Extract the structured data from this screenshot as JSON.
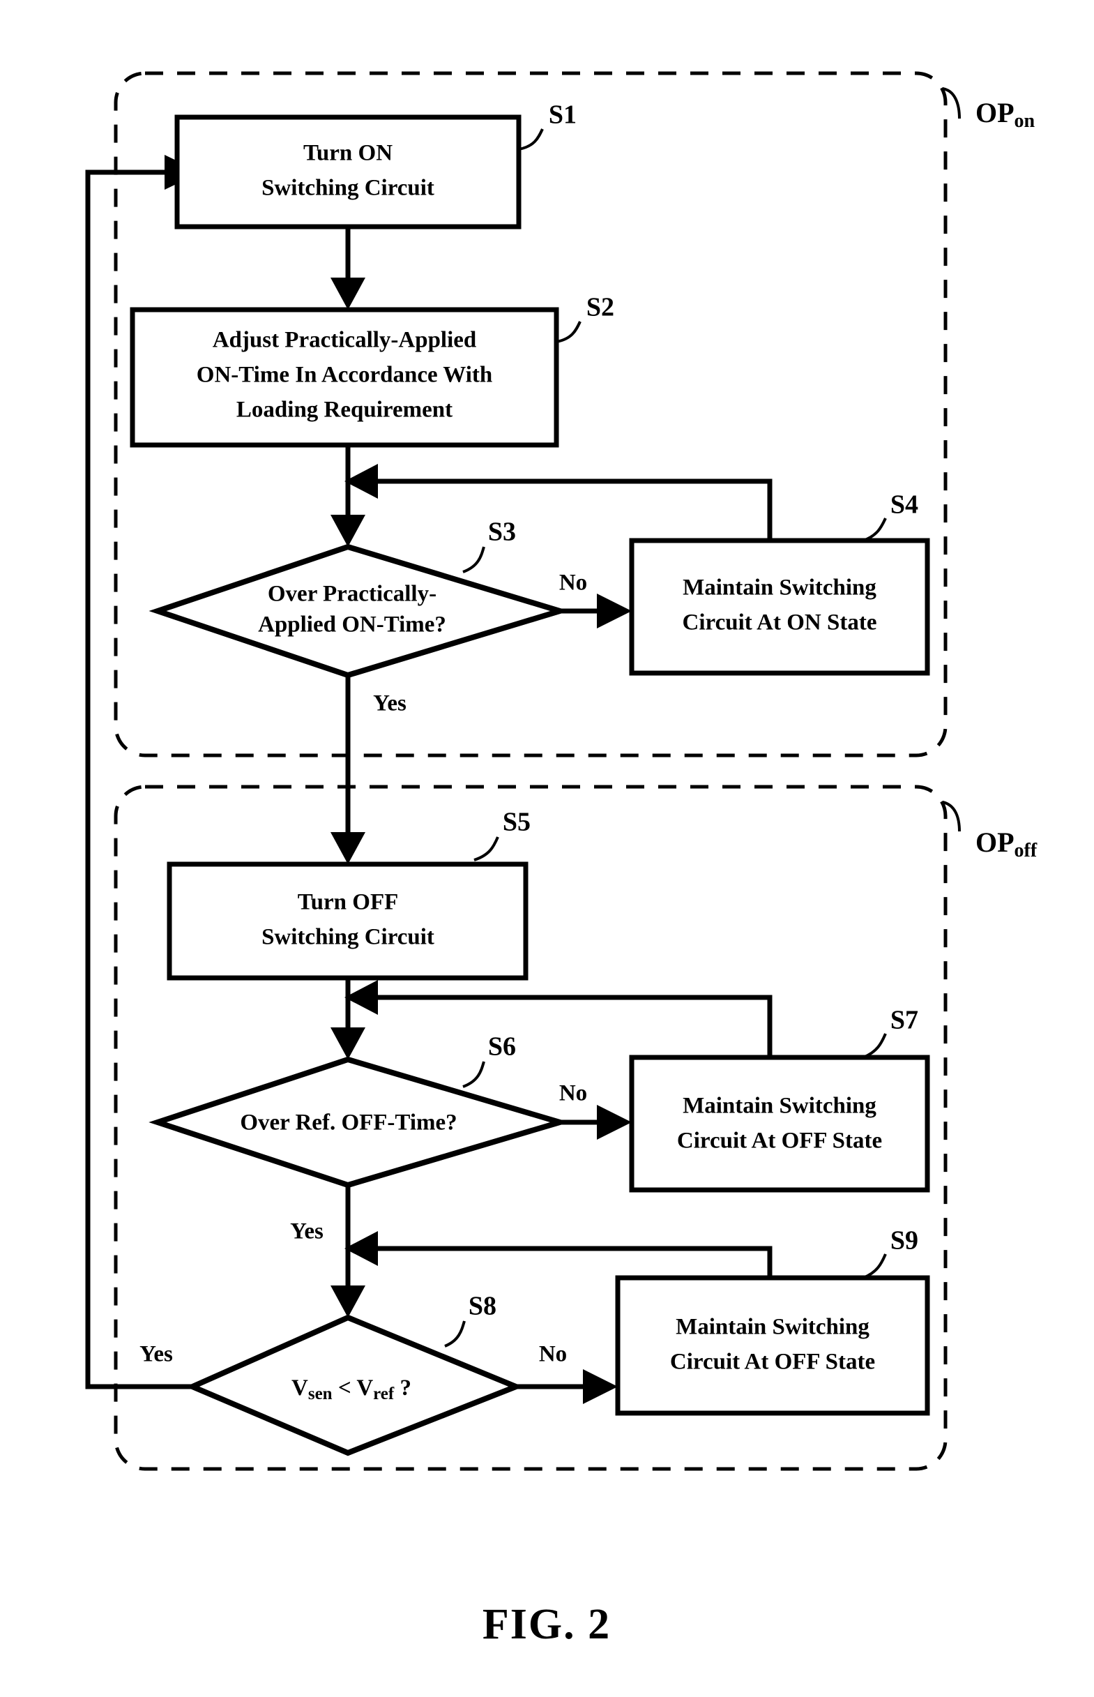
{
  "figure": {
    "caption": "FIG.  2",
    "groups": [
      {
        "id": "OPon",
        "label_main": "OP",
        "label_sub": "on"
      },
      {
        "id": "OPoff",
        "label_main": "OP",
        "label_sub": "off"
      }
    ],
    "nodes": [
      {
        "id": "S1",
        "step": "S1",
        "shape": "process",
        "lines": [
          "Turn ON",
          "Switching Circuit"
        ]
      },
      {
        "id": "S2",
        "step": "S2",
        "shape": "process",
        "lines": [
          "Adjust Practically-Applied",
          "ON-Time In Accordance With",
          "Loading Requirement"
        ]
      },
      {
        "id": "S3",
        "step": "S3",
        "shape": "decision",
        "lines": [
          "Over Practically-",
          "Applied ON-Time?"
        ]
      },
      {
        "id": "S4",
        "step": "S4",
        "shape": "process",
        "lines": [
          "Maintain Switching",
          "Circuit At ON State"
        ]
      },
      {
        "id": "S5",
        "step": "S5",
        "shape": "process",
        "lines": [
          "Turn OFF",
          "Switching Circuit"
        ]
      },
      {
        "id": "S6",
        "step": "S6",
        "shape": "decision",
        "lines": [
          "Over Ref. OFF-Time?"
        ]
      },
      {
        "id": "S7",
        "step": "S7",
        "shape": "process",
        "lines": [
          "Maintain Switching",
          "Circuit At OFF State"
        ]
      },
      {
        "id": "S8",
        "step": "S8",
        "shape": "decision",
        "lines": [
          "Vsen < Vref ?"
        ],
        "expr": {
          "v1": "V",
          "sub1": "sen",
          "op": " < ",
          "v2": "V",
          "sub2": "ref",
          "tail": " ?"
        }
      },
      {
        "id": "S9",
        "step": "S9",
        "shape": "process",
        "lines": [
          "Maintain Switching",
          "Circuit At OFF State"
        ]
      }
    ],
    "edge_labels": {
      "s3_no": "No",
      "s3_yes": "Yes",
      "s6_no": "No",
      "s6_yes": "Yes",
      "s8_no": "No",
      "s8_yes": "Yes"
    },
    "colors": {
      "stroke": "#000000",
      "fill": "#ffffff",
      "background": "#ffffff"
    }
  }
}
